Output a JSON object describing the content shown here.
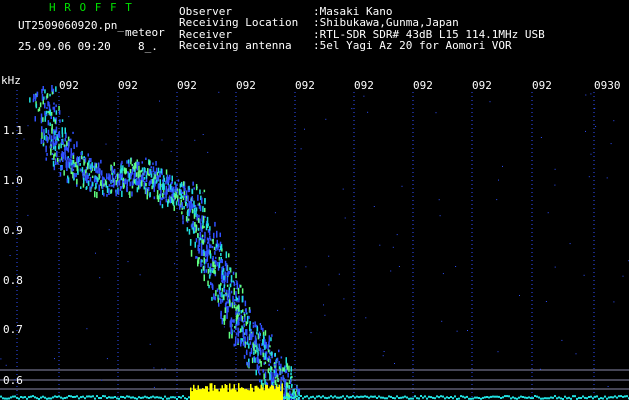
{
  "header": {
    "title": "H R O F F T",
    "filename": "UT2509060920.pn_",
    "tag": "meteor",
    "date": "25.09.06 09:20",
    "code": "8_.",
    "fields": [
      {
        "label": "Observer",
        "value": ":Masaki Kano"
      },
      {
        "label": "Receiving Location",
        "value": ":Shibukawa,Gunma,Japan"
      },
      {
        "label": "Receiver",
        "value": ":RTL-SDR SDR# 43dB L15 114.1MHz USB"
      },
      {
        "label": "Receiving antenna",
        "value": ":5el Yagi Az 20 for Aomori VOR"
      }
    ]
  },
  "axis": {
    "unit": "kHz",
    "y_ticks": [
      "1.1",
      "1.0",
      "0.9",
      "0.8",
      "0.7",
      "0.6"
    ],
    "x_ticks": [
      "092",
      "092",
      "092",
      "092",
      "092",
      "092",
      "092",
      "092",
      "092",
      "0930"
    ]
  },
  "colors": {
    "header_green": "#00e000",
    "axis_blue": "#3050ff",
    "trace_cyan": "#20e0e0",
    "carrier_yellow": "#ffff00"
  }
}
